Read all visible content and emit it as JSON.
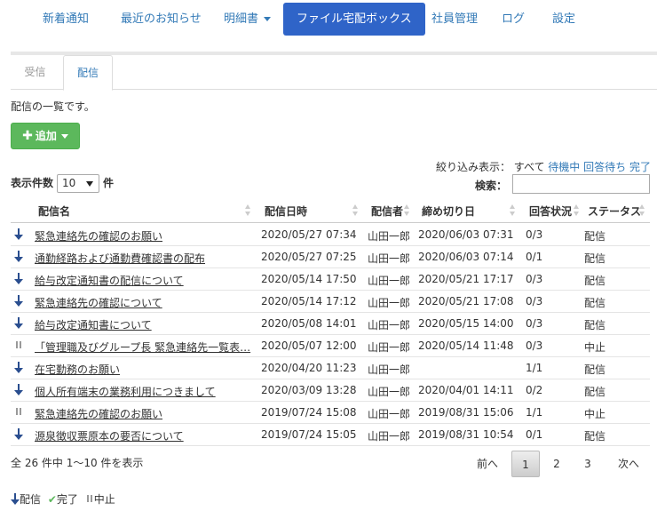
{
  "nav": {
    "items": [
      {
        "label": "新着通知"
      },
      {
        "label": "最近のお知らせ"
      },
      {
        "label": "明細書"
      },
      {
        "label": "ファイル宅配ボックス"
      },
      {
        "label": "社員管理"
      },
      {
        "label": "ログ"
      },
      {
        "label": "設定"
      }
    ]
  },
  "tabs": {
    "received": "受信",
    "sent": "配信"
  },
  "description": "配信の一覧です。",
  "add_button": "追加",
  "filter": {
    "label": "絞り込み表示：",
    "all": "すべて",
    "pending": "待機中",
    "awaiting": "回答待ち",
    "done": "完了"
  },
  "per_page": {
    "label": "表示件数",
    "value": "10",
    "suffix": "件"
  },
  "search": {
    "label": "検索：",
    "value": ""
  },
  "table": {
    "headers": {
      "name": "配信名",
      "date": "配信日時",
      "sender": "配信者",
      "deadline": "締め切り日",
      "responses": "回答状況",
      "status": "ステータス"
    },
    "rows": [
      {
        "icon": "down-arrow-icon",
        "name": "緊急連絡先の確認のお願い",
        "date": "2020/05/27 07:34",
        "sender": "山田一郎",
        "deadline": "2020/06/03 07:31",
        "responses": "0/3",
        "status": "配信"
      },
      {
        "icon": "down-arrow-icon",
        "name": "通勤経路および通勤費確認書の配布",
        "date": "2020/05/27 07:25",
        "sender": "山田一郎",
        "deadline": "2020/06/03 07:14",
        "responses": "0/1",
        "status": "配信"
      },
      {
        "icon": "down-arrow-icon",
        "name": "給与改定通知書の配信について",
        "date": "2020/05/14 17:50",
        "sender": "山田一郎",
        "deadline": "2020/05/21 17:17",
        "responses": "0/3",
        "status": "配信"
      },
      {
        "icon": "down-arrow-icon",
        "name": "緊急連絡先の確認について",
        "date": "2020/05/14 17:12",
        "sender": "山田一郎",
        "deadline": "2020/05/21 17:08",
        "responses": "0/3",
        "status": "配信"
      },
      {
        "icon": "down-arrow-icon",
        "name": "給与改定通知書について",
        "date": "2020/05/08 14:01",
        "sender": "山田一郎",
        "deadline": "2020/05/15 14:00",
        "responses": "0/3",
        "status": "配信"
      },
      {
        "icon": "pause-icon",
        "name": "「管理職及びグループ長 緊急連絡先一覧表…",
        "date": "2020/05/07 12:00",
        "sender": "山田一郎",
        "deadline": "2020/05/14 11:48",
        "responses": "0/3",
        "status": "中止"
      },
      {
        "icon": "down-arrow-icon",
        "name": "在宅勤務のお願い",
        "date": "2020/04/20 11:23",
        "sender": "山田一郎",
        "deadline": "",
        "responses": "1/1",
        "status": "配信"
      },
      {
        "icon": "down-arrow-icon",
        "name": "個人所有端末の業務利用につきまして",
        "date": "2020/03/09 13:28",
        "sender": "山田一郎",
        "deadline": "2020/04/01 14:11",
        "responses": "0/2",
        "status": "配信"
      },
      {
        "icon": "pause-icon",
        "name": "緊急連絡先の確認のお願い",
        "date": "2019/07/24 15:08",
        "sender": "山田一郎",
        "deadline": "2019/08/31 15:06",
        "responses": "1/1",
        "status": "中止"
      },
      {
        "icon": "down-arrow-icon",
        "name": "源泉徴収票原本の要否について",
        "date": "2019/07/24 15:05",
        "sender": "山田一郎",
        "deadline": "2019/08/31 10:54",
        "responses": "0/1",
        "status": "配信"
      }
    ]
  },
  "summary": "全 26 件中 1～10 件を表示",
  "pagination": {
    "prev": "前へ",
    "pages": [
      "1",
      "2",
      "3"
    ],
    "next": "次へ"
  },
  "legend": {
    "sent": "配信",
    "done": "完了",
    "stopped": "中止"
  },
  "colors": {
    "primary": "#2f64c8",
    "link": "#337ab7",
    "add": "#5cb85c"
  }
}
